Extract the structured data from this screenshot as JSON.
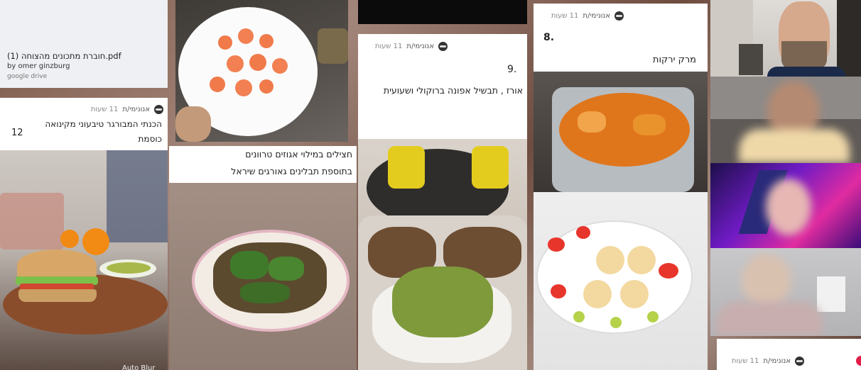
{
  "pdf_card": {
    "title": "(1) חוברת מתכונים מהצוחה.pdf",
    "author": "by omer ginzburg",
    "source": "google drive"
  },
  "post12": {
    "author": "אנונימי/ת",
    "time": "11 שעות",
    "text": "הכנתי המבורגר טיבעוני מקינואה כוסמת",
    "number": "12"
  },
  "post_middle": {
    "caption_line1": "חצילים במילוי אגוזים טרוונים",
    "caption_line2": "בתוספת תבלינים גאורגים   שיראל"
  },
  "post9": {
    "author": "אנונימי/ת",
    "time": "11 שעות",
    "number": "9.",
    "text": "אורז , תבשיל אפונה ברוקולי ושעועית"
  },
  "post8": {
    "author": "אנונימי/ת",
    "time": "11 שעות",
    "number": "8.",
    "text": "מרק ירקות"
  },
  "bottom_post": {
    "author": "אנונימי/ת",
    "time": "11 שעות"
  },
  "overlay_label": "Auto Blur",
  "colors": {
    "accent_red": "#e11d48",
    "panel_bg": "#ffffff"
  }
}
